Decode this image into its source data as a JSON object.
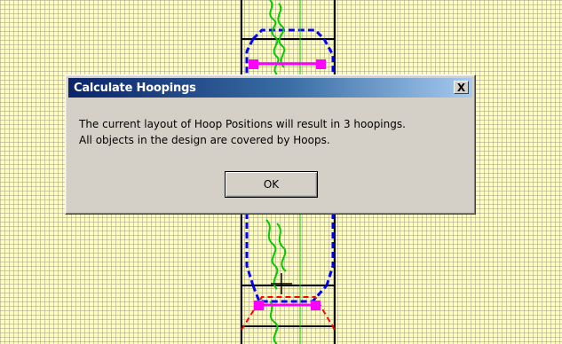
{
  "canvas": {
    "background_color": "#fffcc2",
    "grid_color": "#9a9a8a",
    "hoop_color": "#0000ff",
    "hoop_outline_color": "#000000",
    "handle_color": "#ff00ff",
    "overlap_color": "#ff0000",
    "stitch_color": "#00cc00",
    "cursor_icon": "move-cursor-icon"
  },
  "dialog": {
    "title": "Calculate Hoopings",
    "close_label": "X",
    "message_lines": [
      "The current layout of Hoop Positions will result in 3 hoopings.",
      "All objects in the design are covered by Hoops."
    ],
    "ok_label": "OK"
  }
}
